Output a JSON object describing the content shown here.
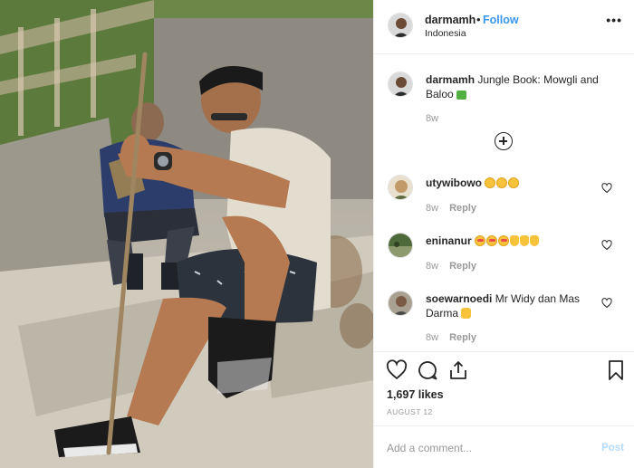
{
  "post": {
    "username": "darmamh",
    "separator": "•",
    "follow_label": "Follow",
    "location": "Indonesia",
    "more_label": "•••",
    "caption": {
      "username": "darmamh",
      "text": "Jungle Book: Mowgli and Baloo",
      "time": "8w"
    },
    "load_more_icon": "plus-circle-icon",
    "comments": [
      {
        "username": "utywibowo",
        "text": "",
        "emojis": [
          "heart",
          "face",
          "face",
          "face"
        ],
        "time": "8w",
        "reply": "Reply"
      },
      {
        "username": "eninanur",
        "text": "",
        "emojis": [
          "star",
          "star",
          "star",
          "thumb",
          "thumb",
          "thumb"
        ],
        "time": "8w",
        "reply": "Reply"
      },
      {
        "username": "soewarnoedi",
        "text": "Mr Widy dan Mas Darma",
        "emojis": [
          "arm"
        ],
        "time": "8w",
        "reply": "Reply"
      }
    ],
    "likes": "1,697 likes",
    "date": "AUGUST 12",
    "comment_placeholder": "Add a comment...",
    "post_label": "Post"
  },
  "colors": {
    "accent": "#3897f0",
    "muted": "#999999",
    "post_disabled": "#b3dbff"
  }
}
